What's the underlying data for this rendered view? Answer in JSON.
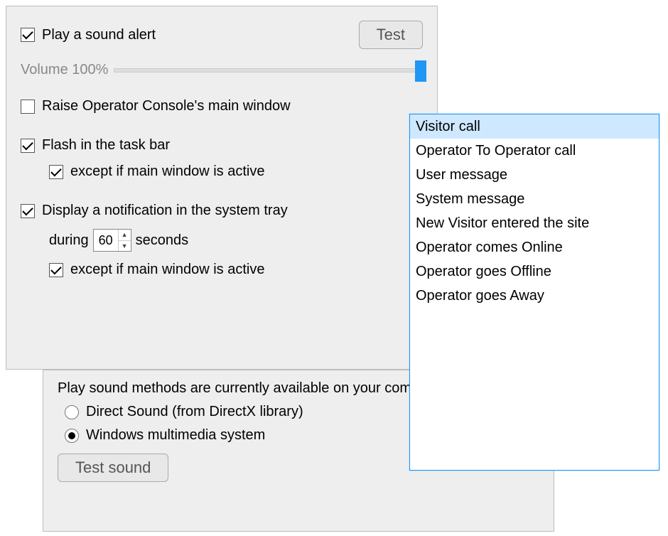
{
  "top": {
    "playSound": {
      "checked": true,
      "label": "Play a sound alert"
    },
    "testBtn": "Test",
    "volumeLabel": "Volume 100%",
    "volumePercent": 100,
    "raiseWindow": {
      "checked": false,
      "label": "Raise Operator Console's main window"
    },
    "flashTaskbar": {
      "checked": true,
      "label": "Flash in the task bar"
    },
    "flashExcept": {
      "checked": true,
      "label": "except if main window is active"
    },
    "displayTray": {
      "checked": true,
      "label": "Display a notification in the system tray"
    },
    "duringPrefix": "during",
    "duringValue": "60",
    "duringSuffix": "seconds",
    "trayExcept": {
      "checked": true,
      "label": "except if main window is active"
    }
  },
  "bottom": {
    "heading": "Play sound methods are currently available on your computer:",
    "direct": {
      "checked": false,
      "label": "Direct Sound (from DirectX library)"
    },
    "wmm": {
      "checked": true,
      "label": "Windows multimedia system"
    },
    "testSoundBtn": "Test sound"
  },
  "list": {
    "items": [
      "Visitor call",
      "Operator To Operator call",
      "User message",
      "System message",
      "New Visitor entered the site",
      "Operator comes Online",
      "Operator goes Offline",
      "Operator goes Away"
    ],
    "selectedIndex": 0
  }
}
